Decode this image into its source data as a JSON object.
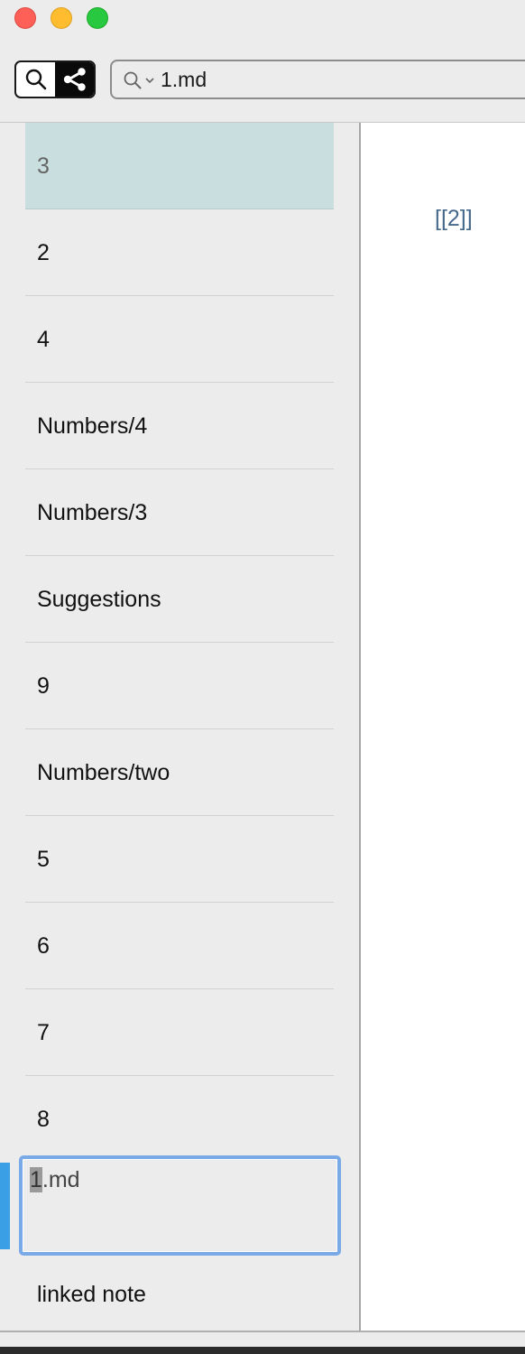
{
  "window": {
    "buttons": [
      "close",
      "minimize",
      "zoom"
    ]
  },
  "toolbar": {
    "mode_buttons": [
      {
        "icon": "search-icon",
        "active": false
      },
      {
        "icon": "share-graph-icon",
        "active": true
      }
    ],
    "search": {
      "value": "1.md",
      "icons": [
        "magnifier-icon",
        "chevron-down-icon"
      ]
    }
  },
  "sidebar": {
    "items": [
      {
        "label": "3",
        "selected": true
      },
      {
        "label": "2"
      },
      {
        "label": "4"
      },
      {
        "label": "Numbers/4"
      },
      {
        "label": "Numbers/3"
      },
      {
        "label": "Suggestions"
      },
      {
        "label": "9"
      },
      {
        "label": "Numbers/two"
      },
      {
        "label": "5"
      },
      {
        "label": "6"
      },
      {
        "label": "7"
      },
      {
        "label": "8"
      }
    ],
    "editing": {
      "selected_part": "1",
      "rest": ".md"
    },
    "after_edit": {
      "label": "linked note"
    }
  },
  "editor": {
    "content": "[[2]]"
  },
  "colors": {
    "selection_row": "#c9dede",
    "edit_focus": "#7aa9e8",
    "edit_marker": "#3b9fe6",
    "link": "#46698c"
  }
}
